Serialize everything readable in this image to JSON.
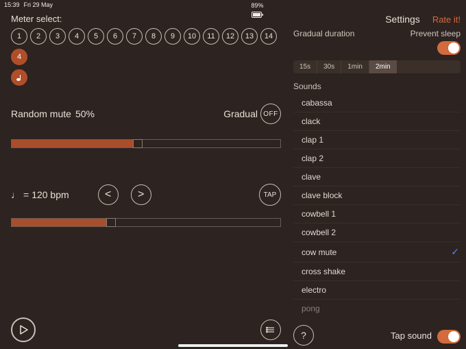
{
  "status": {
    "time": "15:39",
    "date": "Fri 29 May",
    "battery": "89%"
  },
  "left": {
    "meter_label": "Meter select:",
    "meters": [
      "1",
      "2",
      "3",
      "4",
      "5",
      "6",
      "7",
      "8",
      "9",
      "10",
      "11",
      "12",
      "13",
      "14"
    ],
    "selected_meter": "4",
    "random_mute_label": "Random mute",
    "random_mute_value": "50%",
    "gradual_label": "Gradual",
    "gradual_state": "OFF",
    "slider1_percent": 47,
    "tempo_note": "♩",
    "tempo_equals": "=",
    "tempo_value": "120 bpm",
    "dec_label": "<",
    "inc_label": ">",
    "tap_label": "TAP",
    "slider2_percent": 37
  },
  "right": {
    "settings_label": "Settings",
    "rate_label": "Rate it!",
    "gradual_duration_label": "Gradual duration",
    "prevent_sleep_label": "Prevent sleep",
    "durations": [
      "15s",
      "30s",
      "1min",
      "2min"
    ],
    "duration_selected_index": 3,
    "sounds_label": "Sounds",
    "sounds": [
      "cabassa",
      "clack",
      "clap 1",
      "clap 2",
      "clave",
      "clave block",
      "cowbell 1",
      "cowbell 2",
      "cow mute",
      "cross shake",
      "electro",
      "pong"
    ],
    "selected_sound_index": 8,
    "tap_sound_label": "Tap sound"
  }
}
